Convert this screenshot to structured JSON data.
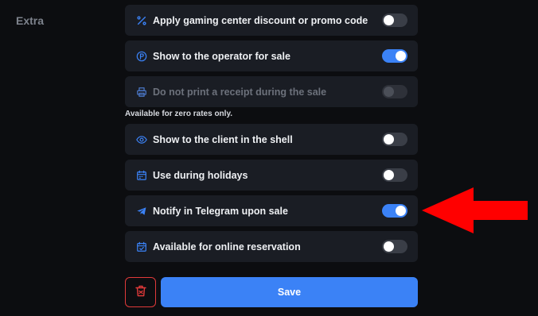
{
  "section": {
    "label": "Extra"
  },
  "colors": {
    "accent": "#3b82f6",
    "danger": "#e03a3a",
    "arrow": "#ff0000"
  },
  "settings": [
    {
      "label": "Apply gaming center discount or promo code",
      "icon": "percent-icon",
      "enabled": false,
      "disabled": false
    },
    {
      "label": "Show to the operator for sale",
      "icon": "parking-icon",
      "enabled": true,
      "disabled": false
    },
    {
      "label": "Do not print a receipt during the sale",
      "icon": "printer-icon",
      "enabled": false,
      "disabled": true
    },
    {
      "label": "Show to the client in the shell",
      "icon": "eye-icon",
      "enabled": false,
      "disabled": false
    },
    {
      "label": "Use during holidays",
      "icon": "calendar-icon",
      "enabled": false,
      "disabled": false
    },
    {
      "label": "Notify in Telegram upon sale",
      "icon": "telegram-icon",
      "enabled": true,
      "disabled": false
    },
    {
      "label": "Available for online reservation",
      "icon": "calendar-check-icon",
      "enabled": false,
      "disabled": false
    }
  ],
  "note": "Available for zero rates only.",
  "actions": {
    "delete_icon": "trash-icon",
    "save_label": "Save"
  },
  "annotation": {
    "icon": "red-arrow-left"
  }
}
